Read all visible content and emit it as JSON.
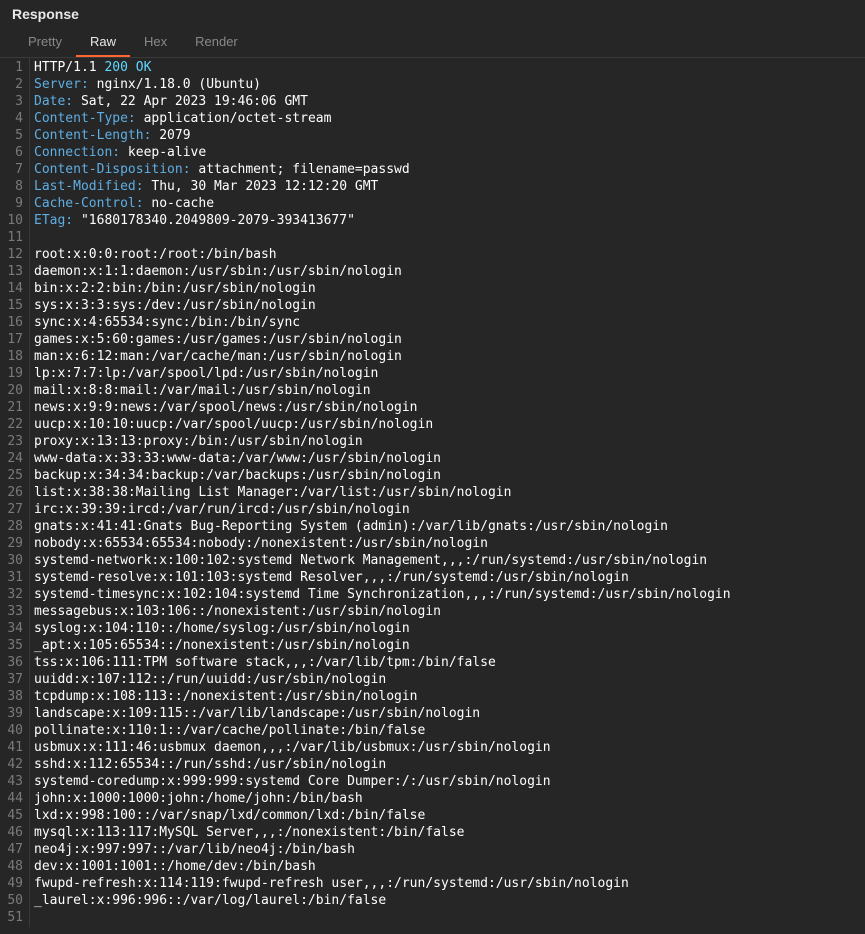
{
  "panel": {
    "title": "Response"
  },
  "tabs": {
    "pretty": "Pretty",
    "raw": "Raw",
    "hex": "Hex",
    "render": "Render",
    "active": "raw"
  },
  "response": {
    "protocol": "HTTP/1.1",
    "status": "200 OK",
    "headers": [
      {
        "key": "Server:",
        "value": "nginx/1.18.0 (Ubuntu)"
      },
      {
        "key": "Date:",
        "value": "Sat, 22 Apr 2023 19:46:06 GMT"
      },
      {
        "key": "Content-Type:",
        "value": "application/octet-stream"
      },
      {
        "key": "Content-Length:",
        "value": "2079"
      },
      {
        "key": "Connection:",
        "value": "keep-alive"
      },
      {
        "key": "Content-Disposition:",
        "value": "attachment; filename=passwd"
      },
      {
        "key": "Last-Modified:",
        "value": "Thu, 30 Mar 2023 12:12:20 GMT"
      },
      {
        "key": "Cache-Control:",
        "value": "no-cache"
      },
      {
        "key": "ETag:",
        "value": "\"1680178340.2049809-2079-393413677\""
      }
    ],
    "body": [
      "root:x:0:0:root:/root:/bin/bash",
      "daemon:x:1:1:daemon:/usr/sbin:/usr/sbin/nologin",
      "bin:x:2:2:bin:/bin:/usr/sbin/nologin",
      "sys:x:3:3:sys:/dev:/usr/sbin/nologin",
      "sync:x:4:65534:sync:/bin:/bin/sync",
      "games:x:5:60:games:/usr/games:/usr/sbin/nologin",
      "man:x:6:12:man:/var/cache/man:/usr/sbin/nologin",
      "lp:x:7:7:lp:/var/spool/lpd:/usr/sbin/nologin",
      "mail:x:8:8:mail:/var/mail:/usr/sbin/nologin",
      "news:x:9:9:news:/var/spool/news:/usr/sbin/nologin",
      "uucp:x:10:10:uucp:/var/spool/uucp:/usr/sbin/nologin",
      "proxy:x:13:13:proxy:/bin:/usr/sbin/nologin",
      "www-data:x:33:33:www-data:/var/www:/usr/sbin/nologin",
      "backup:x:34:34:backup:/var/backups:/usr/sbin/nologin",
      "list:x:38:38:Mailing List Manager:/var/list:/usr/sbin/nologin",
      "irc:x:39:39:ircd:/var/run/ircd:/usr/sbin/nologin",
      "gnats:x:41:41:Gnats Bug-Reporting System (admin):/var/lib/gnats:/usr/sbin/nologin",
      "nobody:x:65534:65534:nobody:/nonexistent:/usr/sbin/nologin",
      "systemd-network:x:100:102:systemd Network Management,,,:/run/systemd:/usr/sbin/nologin",
      "systemd-resolve:x:101:103:systemd Resolver,,,:/run/systemd:/usr/sbin/nologin",
      "systemd-timesync:x:102:104:systemd Time Synchronization,,,:/run/systemd:/usr/sbin/nologin",
      "messagebus:x:103:106::/nonexistent:/usr/sbin/nologin",
      "syslog:x:104:110::/home/syslog:/usr/sbin/nologin",
      "_apt:x:105:65534::/nonexistent:/usr/sbin/nologin",
      "tss:x:106:111:TPM software stack,,,:/var/lib/tpm:/bin/false",
      "uuidd:x:107:112::/run/uuidd:/usr/sbin/nologin",
      "tcpdump:x:108:113::/nonexistent:/usr/sbin/nologin",
      "landscape:x:109:115::/var/lib/landscape:/usr/sbin/nologin",
      "pollinate:x:110:1::/var/cache/pollinate:/bin/false",
      "usbmux:x:111:46:usbmux daemon,,,:/var/lib/usbmux:/usr/sbin/nologin",
      "sshd:x:112:65534::/run/sshd:/usr/sbin/nologin",
      "systemd-coredump:x:999:999:systemd Core Dumper:/:/usr/sbin/nologin",
      "john:x:1000:1000:john:/home/john:/bin/bash",
      "lxd:x:998:100::/var/snap/lxd/common/lxd:/bin/false",
      "mysql:x:113:117:MySQL Server,,,:/nonexistent:/bin/false",
      "neo4j:x:997:997::/var/lib/neo4j:/bin/bash",
      "dev:x:1001:1001::/home/dev:/bin/bash",
      "fwupd-refresh:x:114:119:fwupd-refresh user,,,:/run/systemd:/usr/sbin/nologin",
      "_laurel:x:996:996::/var/log/laurel:/bin/false"
    ]
  }
}
